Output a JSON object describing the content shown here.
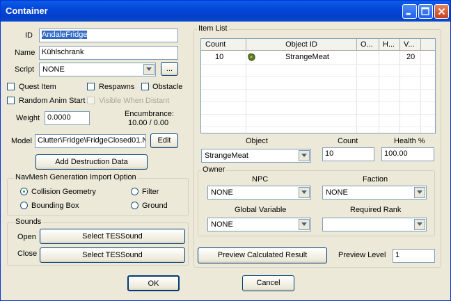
{
  "window": {
    "title": "Container"
  },
  "general": {
    "id_label": "ID",
    "id_value": "AndaleFridge",
    "name_label": "Name",
    "name_value": "Kühlschrank",
    "script_label": "Script",
    "script_value": "NONE",
    "script_browse_label": "..."
  },
  "flags": {
    "quest_item": "Quest Item",
    "respawns": "Respawns",
    "obstacle": "Obstacle",
    "random_anim_start": "Random Anim Start",
    "visible_when_distant": "Visible When Distant"
  },
  "weight": {
    "label": "Weight",
    "value": "0.0000"
  },
  "encumbrance": {
    "label": "Encumbrance:",
    "value": "10.00 / 0.00"
  },
  "model": {
    "label": "Model",
    "value": "Clutter\\Fridge\\FridgeClosed01.N",
    "edit_label": "Edit"
  },
  "destruction": {
    "button_label": "Add Destruction Data"
  },
  "navmesh": {
    "title": "NavMesh Generation Import Option",
    "options": [
      "Collision Geometry",
      "Filter",
      "Bounding Box",
      "Ground"
    ],
    "selected": "Collision Geometry"
  },
  "sounds": {
    "title": "Sounds",
    "open_label": "Open",
    "close_label": "Close",
    "open_button": "Select TESSound",
    "close_button": "Select TESSound"
  },
  "item_list": {
    "title": "Item List",
    "columns": [
      "Count",
      "Object ID",
      "O...",
      "H...",
      "V..."
    ],
    "rows": [
      {
        "count": "10",
        "object_id": "StrangeMeat",
        "owner": "",
        "health": "",
        "value": "20",
        "icon": "meat-icon"
      }
    ]
  },
  "object_edit": {
    "object_label": "Object",
    "object_value": "StrangeMeat",
    "count_label": "Count",
    "count_value": "10",
    "health_label": "Health %",
    "health_value": "100.00"
  },
  "owner": {
    "title": "Owner",
    "npc_label": "NPC",
    "npc_value": "NONE",
    "faction_label": "Faction",
    "faction_value": "NONE",
    "global_label": "Global Variable",
    "global_value": "NONE",
    "rank_label": "Required Rank",
    "rank_value": ""
  },
  "preview": {
    "button_label": "Preview Calculated Result",
    "level_label": "Preview Level",
    "level_value": "1"
  },
  "footer": {
    "ok_label": "OK",
    "cancel_label": "Cancel"
  },
  "colors": {
    "title_bar": "#0546d9",
    "dialog_bg": "#ece9d8",
    "selection": "#316ac5"
  }
}
